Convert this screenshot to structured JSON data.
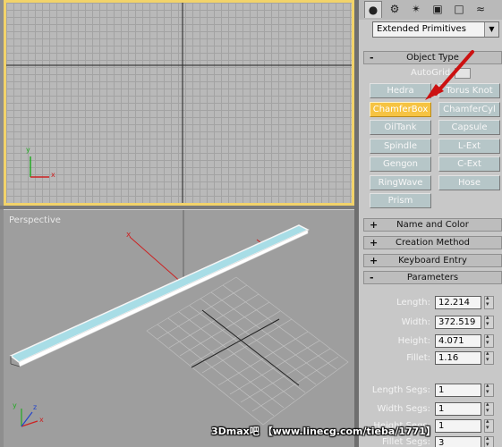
{
  "viewports": {
    "top": {
      "label": "",
      "axis_x": "x",
      "axis_y": "y"
    },
    "perspective": {
      "label": "Perspective",
      "axis_x": "x",
      "axis_y": "y",
      "axis_z": "z"
    }
  },
  "panel": {
    "tabs": [
      {
        "icon": "create-icon",
        "glyph": "●"
      },
      {
        "icon": "modify-icon",
        "glyph": "⚙"
      },
      {
        "icon": "hierarchy-icon",
        "glyph": "✴"
      },
      {
        "icon": "motion-icon",
        "glyph": "▣"
      },
      {
        "icon": "display-icon",
        "glyph": "□"
      },
      {
        "icon": "utilities-icon",
        "glyph": "≈"
      }
    ],
    "category_dropdown": {
      "value": "Extended Primitives",
      "arrow": "▼"
    },
    "object_type": {
      "title": "Object Type",
      "sign": "-",
      "autogrid_label": "AutoGrid",
      "buttons": [
        "Hedra",
        "Torus Knot",
        "ChamferBox",
        "ChamferCyl",
        "OilTank",
        "Capsule",
        "Spindle",
        "L-Ext",
        "Gengon",
        "C-Ext",
        "RingWave",
        "Hose",
        "Prism"
      ],
      "active": "ChamferBox"
    },
    "rollouts": [
      {
        "sign": "+",
        "title": "Name and Color"
      },
      {
        "sign": "+",
        "title": "Creation Method"
      },
      {
        "sign": "+",
        "title": "Keyboard Entry"
      },
      {
        "sign": "-",
        "title": "Parameters"
      }
    ],
    "parameters": [
      {
        "label": "Length:",
        "value": "12.214"
      },
      {
        "label": "Width:",
        "value": "372.519"
      },
      {
        "label": "Height:",
        "value": "4.071"
      },
      {
        "label": "Fillet:",
        "value": "1.16"
      }
    ],
    "segments": [
      {
        "label": "Length Segs:",
        "value": "1"
      },
      {
        "label": "Width Segs:",
        "value": "1"
      },
      {
        "label": "Height Segs:",
        "value": "1"
      },
      {
        "label": "Fillet Segs:",
        "value": "3"
      }
    ]
  },
  "watermark": "3Dmax吧 【www.linecg.com/tieba/1771】",
  "colors": {
    "active_button": "#f6c342",
    "active_viewport_border": "#f2d36a",
    "annotation_arrow": "#cc1111",
    "object_fill": "#a8dde6"
  }
}
